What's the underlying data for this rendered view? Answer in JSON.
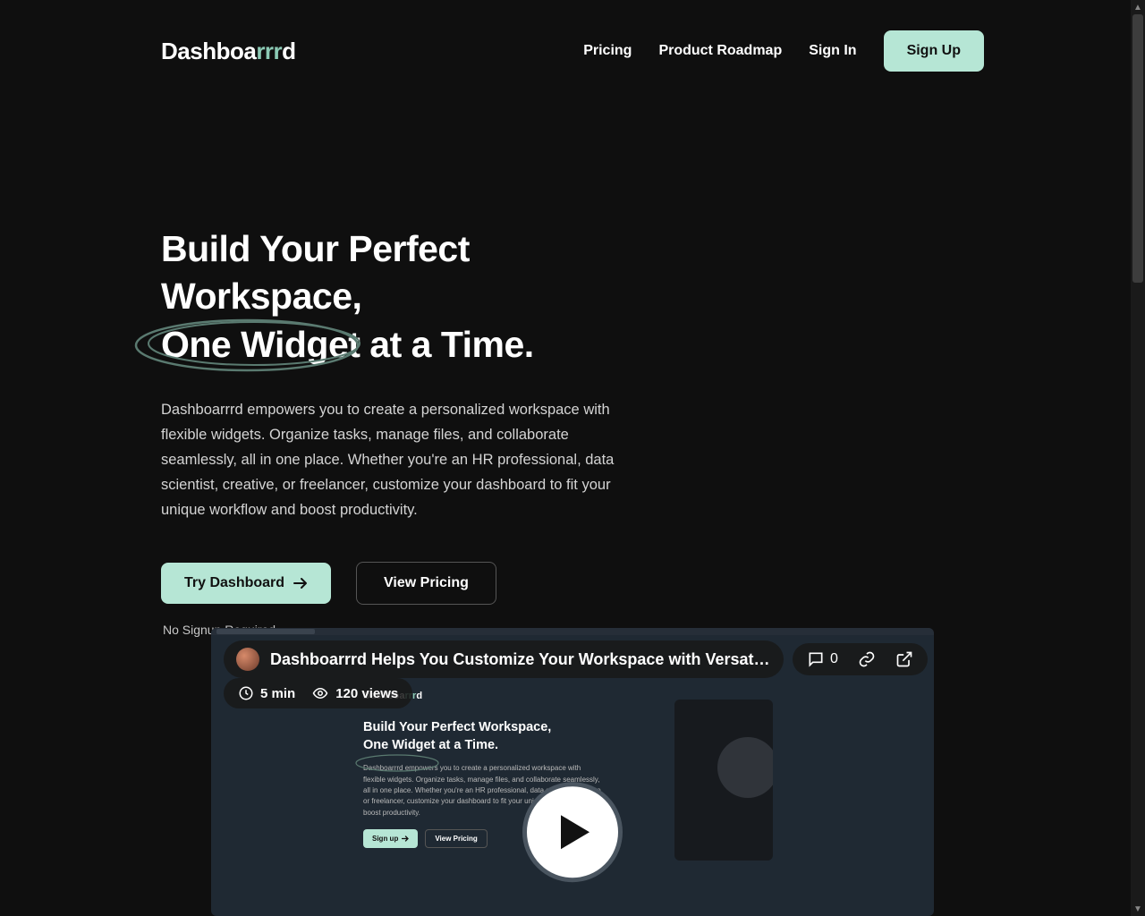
{
  "logo": {
    "part1": "Dashboa",
    "part2": "rrr",
    "part3": "d"
  },
  "nav": {
    "pricing": "Pricing",
    "roadmap": "Product Roadmap",
    "signin": "Sign In",
    "signup": "Sign Up"
  },
  "hero": {
    "title_line1": "Build Your Perfect Workspace,",
    "title_highlight": "One Widget",
    "title_line2_rest": " at a Time.",
    "description": "Dashboarrrd empowers you to create a personalized workspace with flexible widgets. Organize tasks, manage files, and collaborate seamlessly, all in one place. Whether you're an HR professional, data scientist, creative, or freelancer, customize your dashboard to fit your unique workflow and boost productivity.",
    "cta_primary": "Try Dashboard",
    "cta_secondary": "View Pricing",
    "note": "No Signup Required"
  },
  "video": {
    "title": "Dashboarrrd Helps You Customize Your Workspace with Versatile Widge...",
    "comments": "0",
    "duration": "5 min",
    "views": "120 views",
    "thumb_title_line1": "Build Your Perfect Workspace,",
    "thumb_title_line2": "One Widget at a Time.",
    "thumb_desc": "Dashboarrrd empowers you to create a personalized workspace with flexible widgets. Organize tasks, manage files, and collaborate seamlessly, all in one place. Whether you're an HR professional, data scientist, creative, or freelancer, customize your dashboard to fit your unique workflow and boost productivity.",
    "thumb_cta_primary": "Sign up",
    "thumb_cta_secondary": "View Pricing"
  },
  "colors": {
    "accent": "#b6e6d5"
  }
}
